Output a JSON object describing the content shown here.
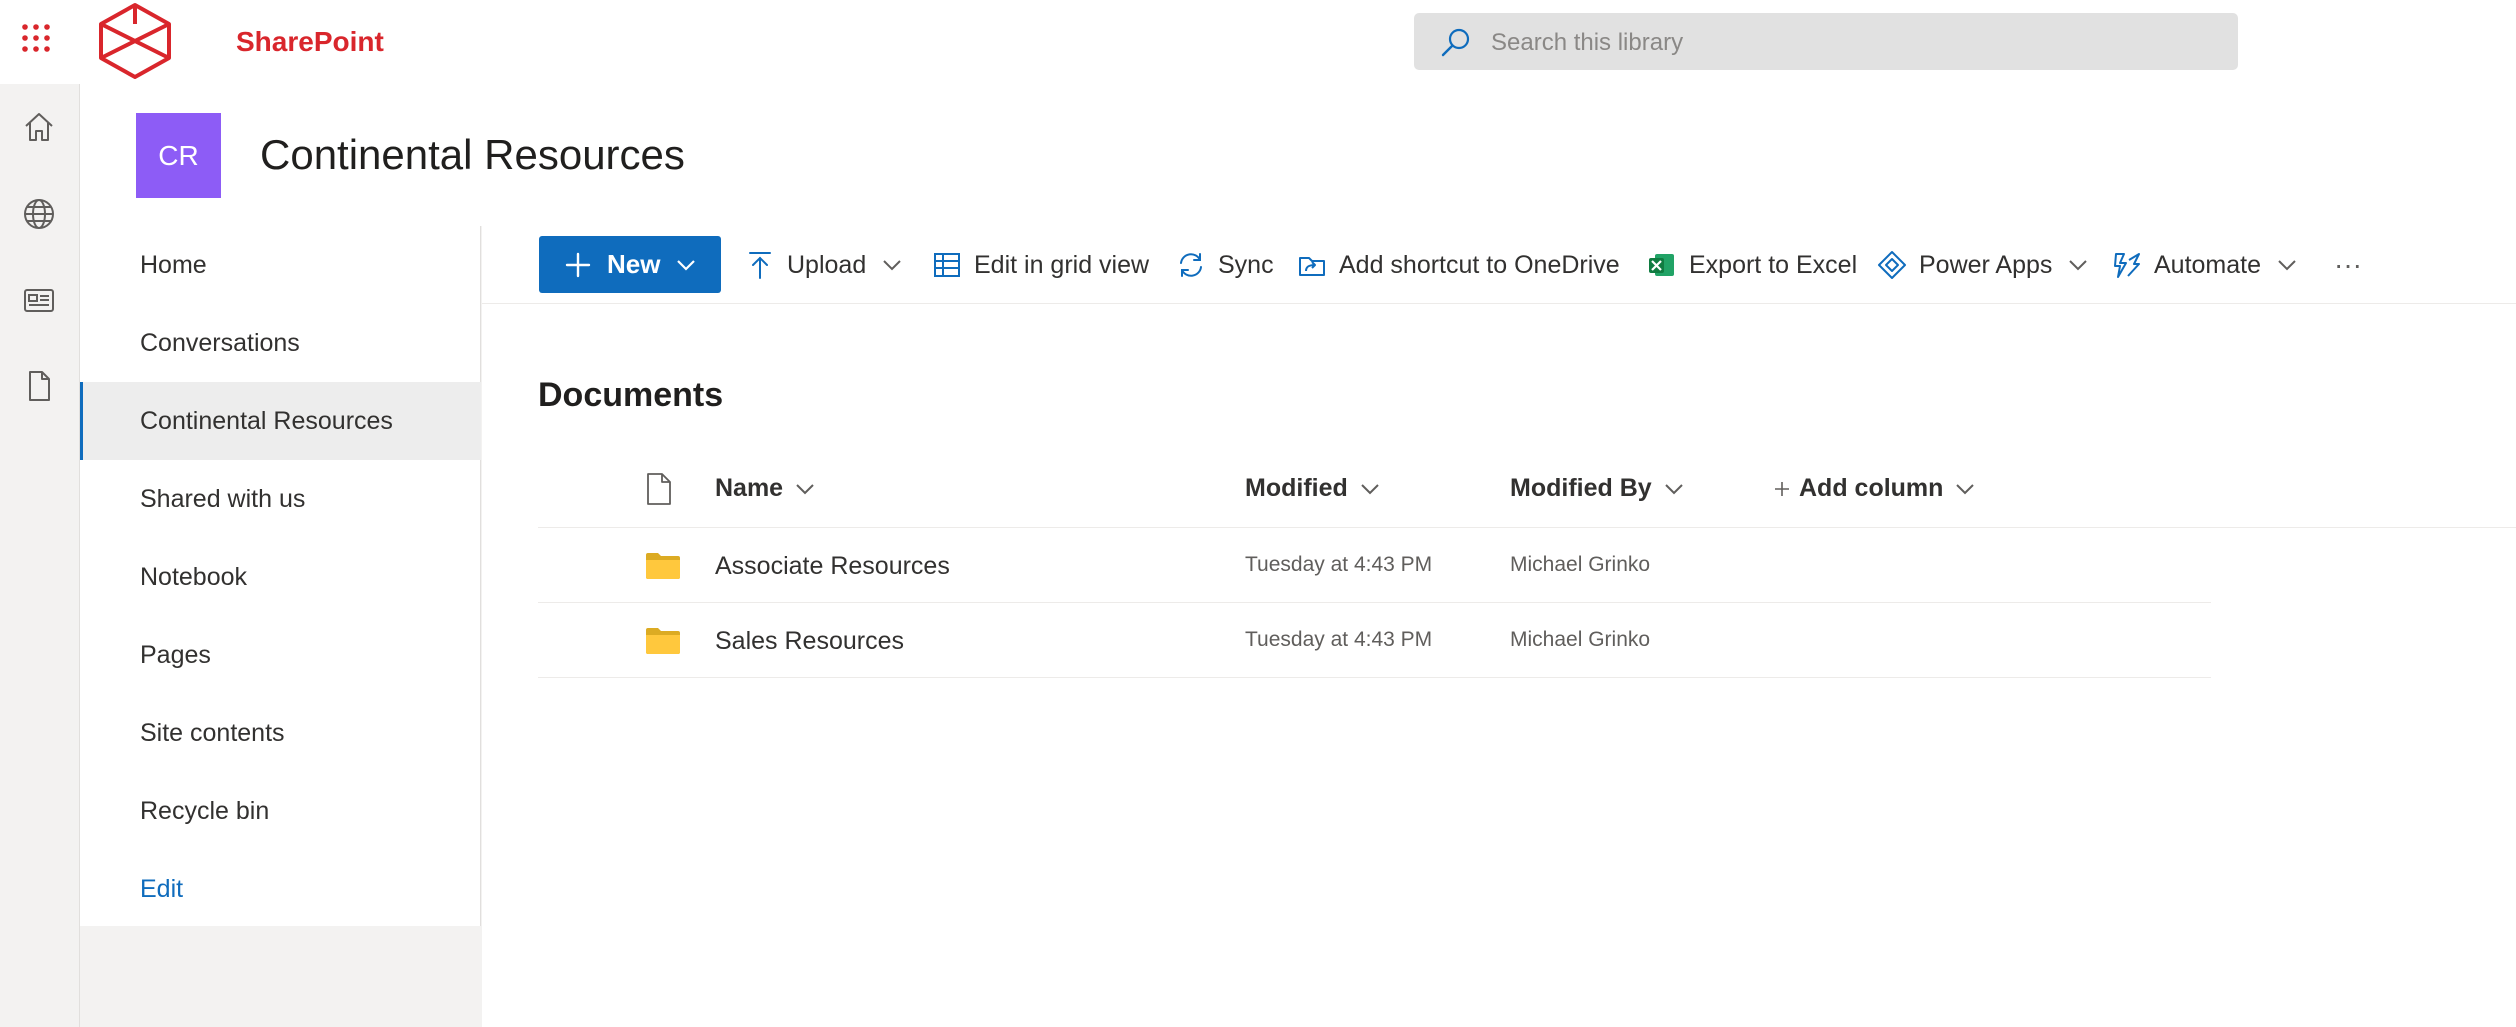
{
  "brand": {
    "name": "SharePoint",
    "color": "#d9262c",
    "logo_icon": "red-hexagon-logo-icon",
    "launcher_icon": "app-launcher-waffle-icon"
  },
  "search": {
    "placeholder": "Search this library",
    "icon": "search-icon"
  },
  "app_bar": [
    {
      "icon": "home-icon"
    },
    {
      "icon": "globe-icon"
    },
    {
      "icon": "news-icon"
    },
    {
      "icon": "document-icon"
    }
  ],
  "site": {
    "logo_initials": "CR",
    "logo_color": "#8d5cf6",
    "title": "Continental Resources"
  },
  "nav": {
    "items": [
      {
        "label": "Home"
      },
      {
        "label": "Conversations"
      },
      {
        "label": "Continental Resources",
        "selected": true
      },
      {
        "label": "Shared with us"
      },
      {
        "label": "Notebook"
      },
      {
        "label": "Pages"
      },
      {
        "label": "Site contents"
      },
      {
        "label": "Recycle bin"
      }
    ],
    "edit_label": "Edit"
  },
  "commands": {
    "new": "New",
    "upload": "Upload",
    "edit_grid": "Edit in grid view",
    "sync": "Sync",
    "add_shortcut": "Add shortcut to OneDrive",
    "export_excel": "Export to Excel",
    "power_apps": "Power Apps",
    "automate": "Automate",
    "more": "···",
    "accent": "#0f6cbd"
  },
  "library": {
    "title": "Documents",
    "columns": {
      "name": "Name",
      "modified": "Modified",
      "modified_by": "Modified By",
      "add_column": "Add column"
    },
    "rows": [
      {
        "name": "Associate Resources",
        "modified": "Tuesday at 4:43 PM",
        "modified_by": "Michael Grinko",
        "type": "folder"
      },
      {
        "name": "Sales Resources",
        "modified": "Tuesday at 4:43 PM",
        "modified_by": "Michael Grinko",
        "type": "folder"
      }
    ]
  }
}
